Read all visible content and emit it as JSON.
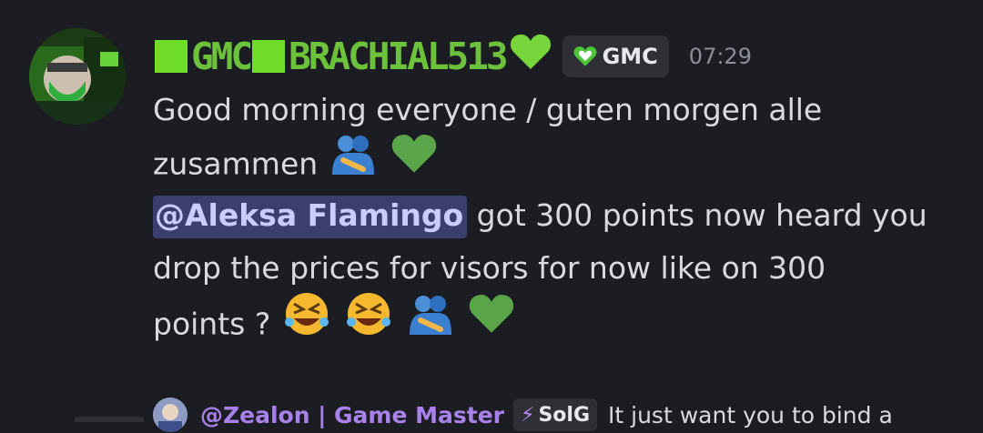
{
  "message": {
    "author": {
      "prefix": "GMC",
      "name": "BRACHIAL513",
      "name_color": "#6cc23a",
      "badge_icon": "green-heart-icon"
    },
    "role_tag": {
      "icon": "green-heart-icon",
      "label": "GMC"
    },
    "time": "07:29",
    "lines": {
      "l1": "Good morning everyone  / guten morgen alle",
      "l2": "zusammen",
      "l3_mention": "@Aleksa Flamingo",
      "l3_text": " got 300 points now heard you",
      "l4": "drop the prices for visors for now like on 300",
      "l5": "points ?"
    },
    "emojis": [
      "people-hugging-icon",
      "green-heart-icon",
      "rolling-laughing-icon"
    ]
  },
  "reply": {
    "author": "@Zealon | Game Master",
    "tag": "SolG",
    "text": "It just want you to bind a"
  },
  "colors": {
    "background": "#1c1d22",
    "mention_bg": "#3b3f6e",
    "mention_fg": "#c9cdfb",
    "reply_name": "#a882e8"
  }
}
